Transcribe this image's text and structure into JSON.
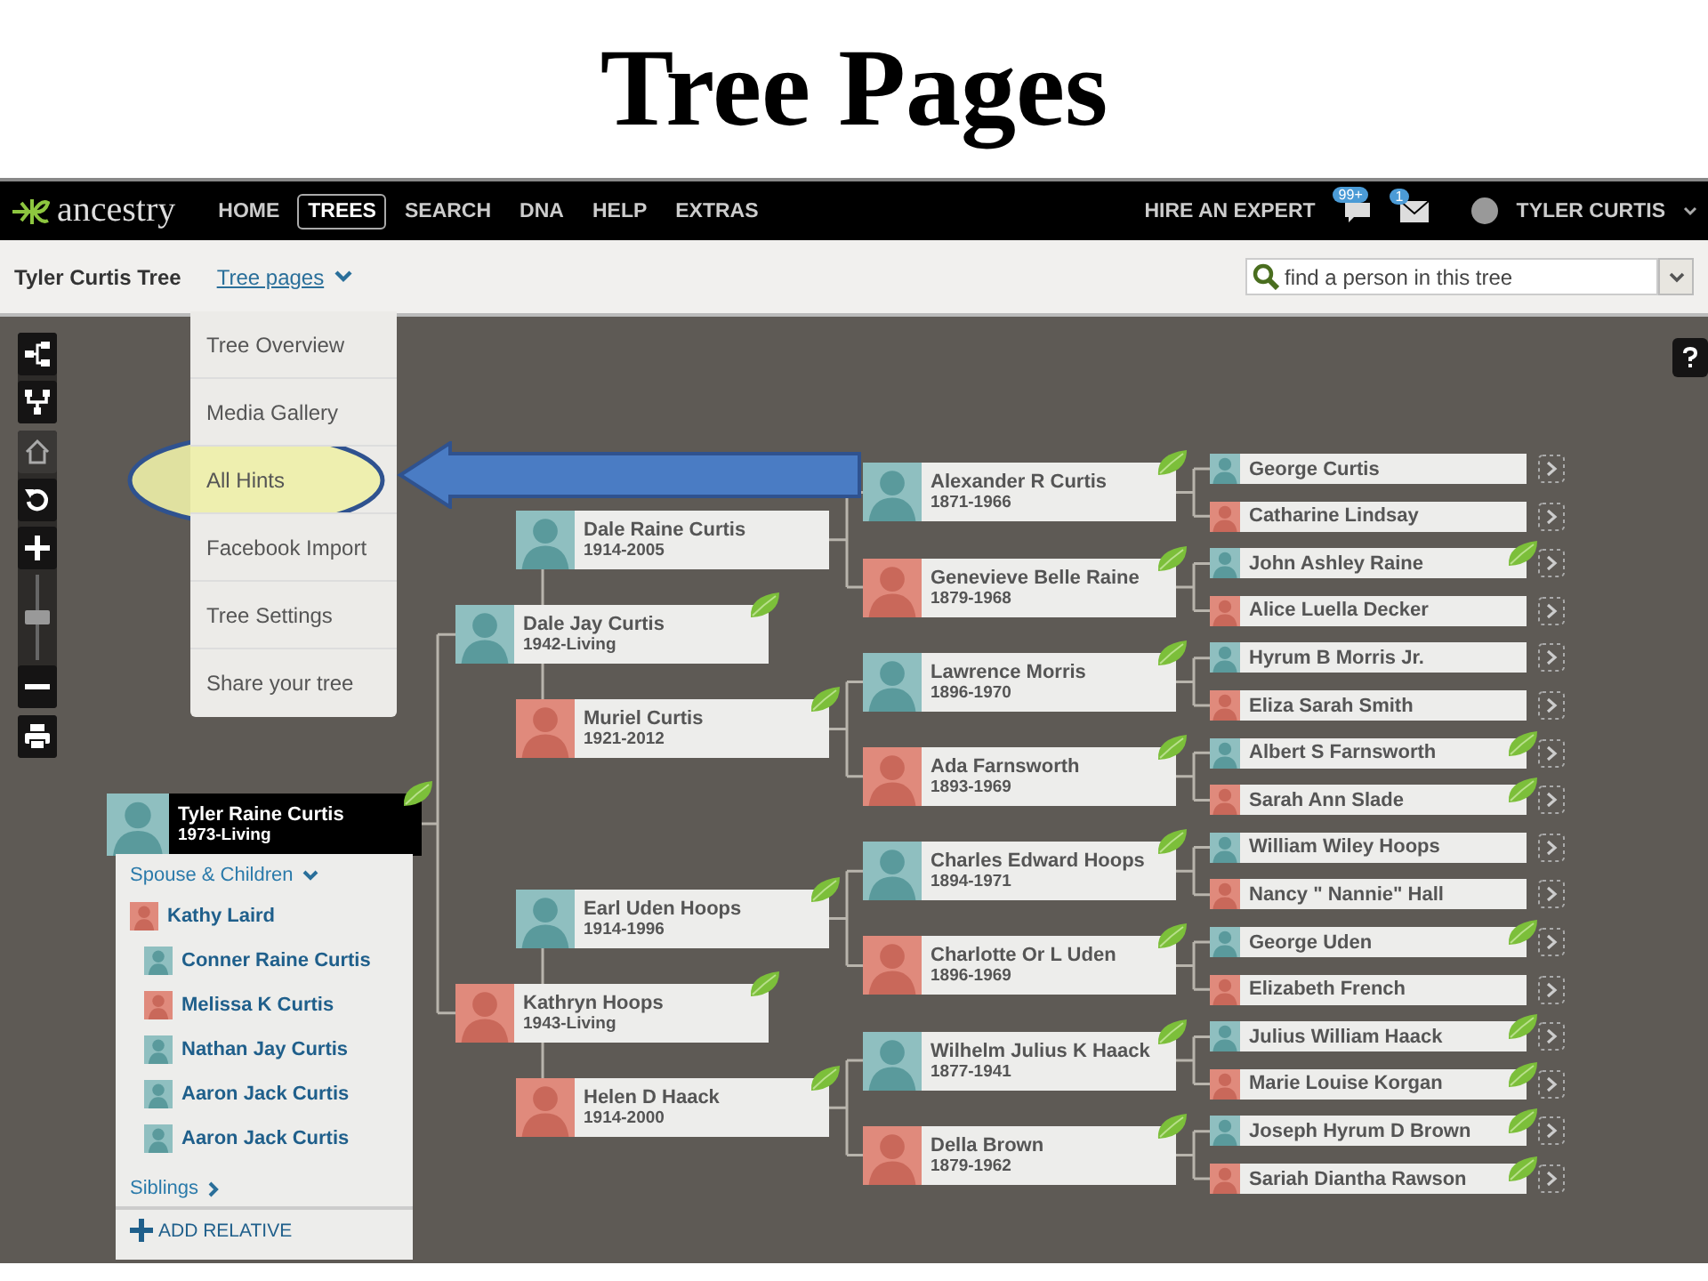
{
  "slide_title": "Tree Pages",
  "navbar": {
    "logo": "ancestry",
    "links": [
      {
        "label": "HOME",
        "selected": false
      },
      {
        "label": "TREES",
        "selected": true
      },
      {
        "label": "SEARCH",
        "selected": false
      },
      {
        "label": "DNA",
        "selected": false
      },
      {
        "label": "HELP",
        "selected": false
      },
      {
        "label": "EXTRAS",
        "selected": false
      }
    ],
    "hire": "HIRE AN EXPERT",
    "message_badge": "99+",
    "mail_badge": "1",
    "user": "TYLER CURTIS"
  },
  "subbar": {
    "tree_name": "Tyler Curtis Tree",
    "tree_pages": "Tree pages",
    "search": {
      "placeholder": "find a person in this tree"
    }
  },
  "menu": {
    "items": [
      {
        "label": "Tree Overview",
        "circled": false
      },
      {
        "label": "Media Gallery",
        "circled": false
      },
      {
        "label": "All Hints",
        "circled": true
      },
      {
        "label": "Facebook Import",
        "circled": false
      },
      {
        "label": "Tree Settings",
        "circled": false
      },
      {
        "label": "Share your tree",
        "circled": false
      }
    ]
  },
  "zoom": {
    "level": 0.5
  },
  "tree": {
    "root": {
      "name": "Tyler Raine Curtis",
      "dates": "1973-Living",
      "female": false,
      "hint": true,
      "parents": [
        {
          "name": "Dale Jay Curtis",
          "dates": "1942-Living",
          "female": false,
          "hint": true,
          "parents": [
            {
              "name": "Dale Raine Curtis",
              "dates": "1914-2005",
              "female": false,
              "hint": false,
              "parents": [
                {
                  "name": "Alexander R Curtis",
                  "dates": "1871-1966",
                  "female": false,
                  "hint": true,
                  "parents": [
                    {
                      "name": "George Curtis",
                      "female": false,
                      "hint": false
                    },
                    {
                      "name": "Catharine Lindsay",
                      "female": true,
                      "hint": false
                    }
                  ]
                },
                {
                  "name": "Genevieve Belle Raine",
                  "dates": "1879-1968",
                  "female": true,
                  "hint": true,
                  "parents": [
                    {
                      "name": "John Ashley Raine",
                      "female": false,
                      "hint": true
                    },
                    {
                      "name": "Alice Luella Decker",
                      "female": true,
                      "hint": false
                    }
                  ]
                }
              ]
            },
            {
              "name": "Muriel Curtis",
              "dates": "1921-2012",
              "female": true,
              "hint": true,
              "parents": [
                {
                  "name": "Lawrence Morris",
                  "dates": "1896-1970",
                  "female": false,
                  "hint": true,
                  "parents": [
                    {
                      "name": "Hyrum B Morris Jr.",
                      "female": false,
                      "hint": false
                    },
                    {
                      "name": "Eliza Sarah Smith",
                      "female": true,
                      "hint": false
                    }
                  ]
                },
                {
                  "name": "Ada Farnsworth",
                  "dates": "1893-1969",
                  "female": true,
                  "hint": true,
                  "parents": [
                    {
                      "name": "Albert S Farnsworth",
                      "female": false,
                      "hint": true
                    },
                    {
                      "name": "Sarah Ann Slade",
                      "female": true,
                      "hint": true
                    }
                  ]
                }
              ]
            }
          ]
        },
        {
          "name": "Kathryn Hoops",
          "dates": "1943-Living",
          "female": true,
          "hint": true,
          "parents": [
            {
              "name": "Earl Uden Hoops",
              "dates": "1914-1996",
              "female": false,
              "hint": true,
              "parents": [
                {
                  "name": "Charles Edward Hoops",
                  "dates": "1894-1971",
                  "female": false,
                  "hint": true,
                  "parents": [
                    {
                      "name": "William Wiley Hoops",
                      "female": false,
                      "hint": false
                    },
                    {
                      "name": "Nancy \" Nannie\" Hall",
                      "female": true,
                      "hint": false
                    }
                  ]
                },
                {
                  "name": "Charlotte Or L Uden",
                  "dates": "1896-1969",
                  "female": true,
                  "hint": true,
                  "parents": [
                    {
                      "name": "George Uden",
                      "female": false,
                      "hint": true
                    },
                    {
                      "name": "Elizabeth French",
                      "female": true,
                      "hint": false
                    }
                  ]
                }
              ]
            },
            {
              "name": "Helen D Haack",
              "dates": "1914-2000",
              "female": true,
              "hint": true,
              "parents": [
                {
                  "name": "Wilhelm Julius K Haack",
                  "dates": "1877-1941",
                  "female": false,
                  "hint": true,
                  "parents": [
                    {
                      "name": "Julius William Haack",
                      "female": false,
                      "hint": true
                    },
                    {
                      "name": "Marie Louise Korgan",
                      "female": true,
                      "hint": true
                    }
                  ]
                },
                {
                  "name": "Della Brown",
                  "dates": "1879-1962",
                  "female": true,
                  "hint": true,
                  "parents": [
                    {
                      "name": "Joseph Hyrum D Brown",
                      "female": false,
                      "hint": true
                    },
                    {
                      "name": "Sariah Diantha Rawson",
                      "female": true,
                      "hint": true
                    }
                  ]
                }
              ]
            }
          ]
        }
      ]
    }
  },
  "family": {
    "heading": "Spouse & Children",
    "spouse": {
      "name": "Kathy Laird",
      "female": true
    },
    "children": [
      {
        "name": "Conner Raine Curtis",
        "female": false
      },
      {
        "name": "Melissa K Curtis",
        "female": true
      },
      {
        "name": "Nathan Jay Curtis",
        "female": false
      },
      {
        "name": "Aaron Jack Curtis",
        "female": false
      },
      {
        "name": "Aaron Jack Curtis",
        "female": false
      }
    ],
    "siblings": "Siblings",
    "add_relative": "ADD RELATIVE"
  }
}
